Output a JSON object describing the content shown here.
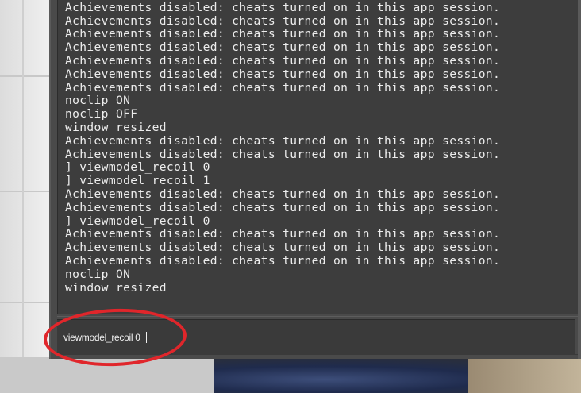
{
  "console": {
    "output_lines": [
      "Achievements disabled: cheats turned on in this app session.",
      "Achievements disabled: cheats turned on in this app session.",
      "Achievements disabled: cheats turned on in this app session.",
      "Achievements disabled: cheats turned on in this app session.",
      "Achievements disabled: cheats turned on in this app session.",
      "Achievements disabled: cheats turned on in this app session.",
      "Achievements disabled: cheats turned on in this app session.",
      "Achievements disabled: cheats turned on in this app session.",
      "noclip ON",
      "noclip OFF",
      "window resized",
      "Achievements disabled: cheats turned on in this app session.",
      "Achievements disabled: cheats turned on in this app session.",
      "] viewmodel_recoil 0",
      "] viewmodel_recoil 1",
      "Achievements disabled: cheats turned on in this app session.",
      "Achievements disabled: cheats turned on in this app session.",
      "] viewmodel_recoil 0",
      "Achievements disabled: cheats turned on in this app session.",
      "Achievements disabled: cheats turned on in this app session.",
      "Achievements disabled: cheats turned on in this app session.",
      "noclip ON",
      "window resized"
    ],
    "input_value": "viewmodel_recoil 0"
  },
  "colors": {
    "console_bg": "#3d3d3d",
    "text": "#ededed",
    "highlight": "#e0262b"
  }
}
